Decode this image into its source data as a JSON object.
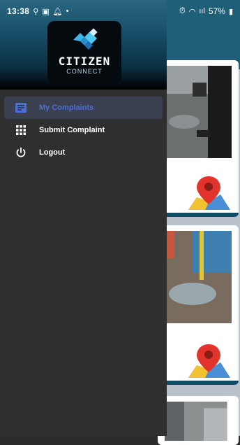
{
  "status_bar": {
    "time": "13:38",
    "battery": "57%",
    "network": "ııl"
  },
  "drawer": {
    "logo": {
      "title": "CITIZEN",
      "subtitle": "CONNECT"
    },
    "menu": [
      {
        "label": "My Complaints",
        "icon": "complaints-icon",
        "active": true
      },
      {
        "label": "Submit Complaint",
        "icon": "grid-icon",
        "active": false
      },
      {
        "label": "Logout",
        "icon": "power-icon",
        "active": false
      }
    ]
  },
  "colors": {
    "drawer_bg": "#2f2f2f",
    "active_item": "#4b6fd8",
    "app_bar": "#1f5f77"
  }
}
